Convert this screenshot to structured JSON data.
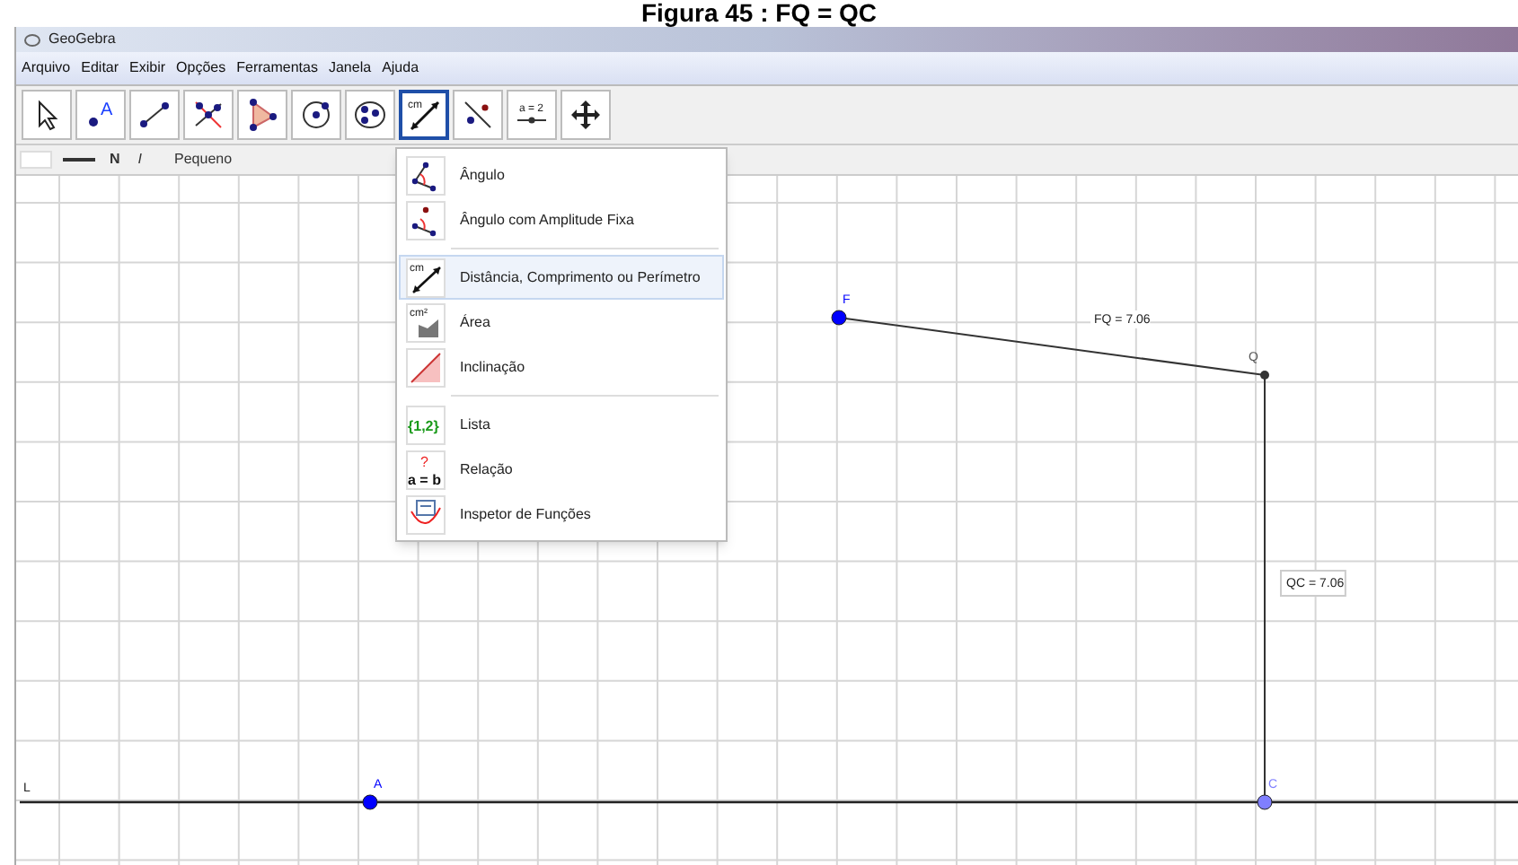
{
  "caption": "Figura 45 : FQ = QC",
  "window": {
    "title": "GeoGebra"
  },
  "menu_bar": [
    "Arquivo",
    "Editar",
    "Exibir",
    "Opções",
    "Ferramentas",
    "Janela",
    "Ajuda"
  ],
  "toolbar": [
    {
      "kind": "move",
      "selected": false
    },
    {
      "kind": "point",
      "selected": false,
      "icon_text": "A"
    },
    {
      "kind": "segment",
      "selected": false
    },
    {
      "kind": "perpendicular",
      "selected": false
    },
    {
      "kind": "polygon",
      "selected": false
    },
    {
      "kind": "circle",
      "selected": false
    },
    {
      "kind": "conic",
      "selected": false
    },
    {
      "kind": "measure",
      "selected": true,
      "icon_text": "cm"
    },
    {
      "kind": "reflect",
      "selected": false
    },
    {
      "kind": "slider",
      "selected": false,
      "icon_text": "a = 2"
    },
    {
      "kind": "pan",
      "selected": false
    }
  ],
  "style_bar": {
    "bold": "N",
    "italic": "I",
    "size": "Pequeno"
  },
  "tool_menu": [
    [
      {
        "kind": "angle",
        "label": "Ângulo",
        "selected": false
      },
      {
        "kind": "angle-fixed",
        "label": "Ângulo com Amplitude Fixa",
        "selected": false
      }
    ],
    [
      {
        "kind": "distance",
        "label": "Distância, Comprimento ou Perímetro",
        "selected": true,
        "icon_text": "cm"
      },
      {
        "kind": "area",
        "label": "Área",
        "selected": false,
        "icon_text": "cm²"
      },
      {
        "kind": "slope",
        "label": "Inclinação",
        "selected": false
      }
    ],
    [
      {
        "kind": "list",
        "label": "Lista",
        "selected": false,
        "icon_text": "{1,2}"
      },
      {
        "kind": "relation",
        "label": "Relação",
        "selected": false,
        "icon_text": "?",
        "icon_text_2": "a = b"
      },
      {
        "kind": "inspector",
        "label": "Inspetor de Funções",
        "selected": false
      }
    ]
  ],
  "graphics": {
    "line_label": "L",
    "points": [
      {
        "label": "F",
        "color": "#0000ff"
      },
      {
        "label": "Q",
        "color": "#333333"
      },
      {
        "label": "A",
        "color": "#0000ff"
      },
      {
        "label": "C",
        "color": "#7f7fff"
      }
    ],
    "measurements": [
      {
        "text": "FQ = 7.06",
        "boxed": false
      },
      {
        "text": "QC = 7.06",
        "boxed": true
      }
    ]
  }
}
